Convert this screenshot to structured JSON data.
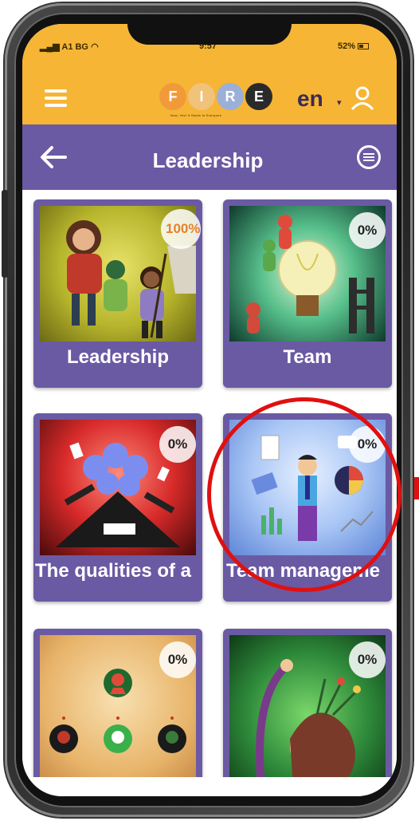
{
  "status": {
    "carrier": "A1 BG",
    "time": "9:57",
    "battery": "52%"
  },
  "header": {
    "logo_letters": [
      "F",
      "I",
      "R",
      "E"
    ],
    "logo_colors": [
      "#f29a3a",
      "#f0c27a",
      "#9bb0d8",
      "#2a2a2a"
    ],
    "logo_tagline": "Now, Yes! It Starts In Everyone",
    "language": "en",
    "language_caret": "▾"
  },
  "titlebar": {
    "title": "Leadership"
  },
  "cards": [
    {
      "label": "Leadership",
      "progress": "100%"
    },
    {
      "label": "Team",
      "progress": "0%"
    },
    {
      "label": "The qualities of a",
      "progress": "0%"
    },
    {
      "label": "Team manageme",
      "progress": "0%"
    },
    {
      "label": "",
      "progress": "0%"
    },
    {
      "label": "",
      "progress": "0%"
    }
  ],
  "colors": {
    "header_yellow": "#f6b535",
    "brand_purple": "#6a5aa3",
    "highlight_red": "#e01010"
  }
}
